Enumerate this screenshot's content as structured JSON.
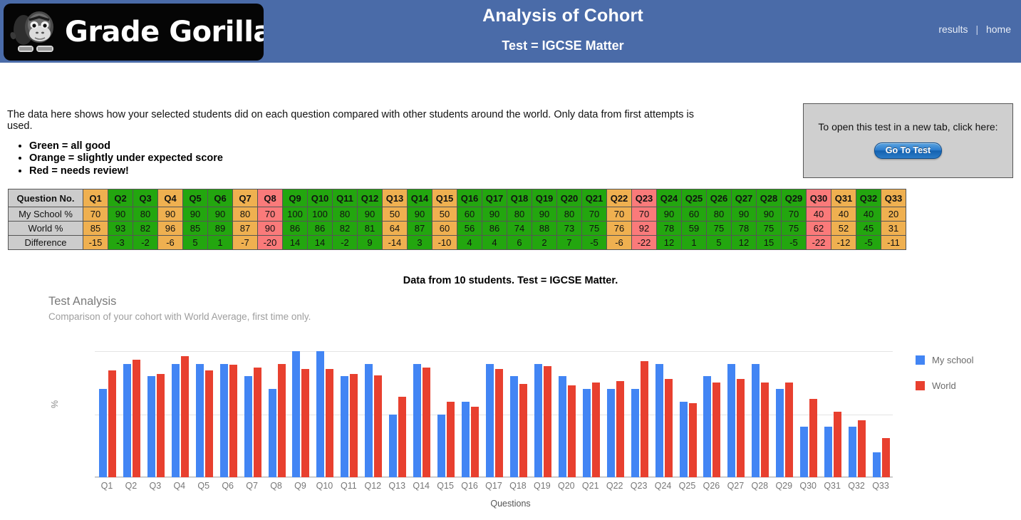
{
  "header": {
    "logo_text": "Grade Gorilla",
    "title": "Analysis of Cohort",
    "subtitle": "Test = IGCSE Matter",
    "link_results": "results",
    "link_sep": "|",
    "link_home": "home"
  },
  "intro": {
    "paragraph": "The data here shows how your selected students did on each question compared with other students around the world. Only data from first attempts is used.",
    "bullets": [
      "Green = all good",
      "Orange = slightly under expected score",
      "Red = needs review!"
    ]
  },
  "test_panel": {
    "text": "To open this test in a new tab, click here:",
    "button_label": "Go To Test"
  },
  "table": {
    "row_labels": [
      "Question No.",
      "My School %",
      "World %",
      "Difference"
    ],
    "caption": "Data from 10 students. Test = IGCSE Matter."
  },
  "colors": {
    "green": "#23a60f",
    "orange": "#efb050",
    "red": "#fa7a7a",
    "header_blue": "#4a6ba8",
    "series_my_school": "#4285f4",
    "series_world": "#e8402f"
  },
  "chart_data": {
    "type": "bar",
    "title": "Test Analysis",
    "subtitle": "Comparison of your cohort with World Average, first time only.",
    "xlabel": "Questions",
    "ylabel": "%",
    "ylim": [
      0,
      100
    ],
    "yticks": [
      0,
      50,
      100
    ],
    "grid": true,
    "legend_position": "right",
    "categories": [
      "Q1",
      "Q2",
      "Q3",
      "Q4",
      "Q5",
      "Q6",
      "Q7",
      "Q8",
      "Q9",
      "Q10",
      "Q11",
      "Q12",
      "Q13",
      "Q14",
      "Q15",
      "Q16",
      "Q17",
      "Q18",
      "Q19",
      "Q20",
      "Q21",
      "Q22",
      "Q23",
      "Q24",
      "Q25",
      "Q26",
      "Q27",
      "Q28",
      "Q29",
      "Q30",
      "Q31",
      "Q32",
      "Q33"
    ],
    "series": [
      {
        "name": "My school",
        "color": "#4285f4",
        "values": [
          70,
          90,
          80,
          90,
          90,
          90,
          80,
          70,
          100,
          100,
          80,
          90,
          50,
          90,
          50,
          60,
          90,
          80,
          90,
          80,
          70,
          70,
          70,
          90,
          60,
          80,
          90,
          90,
          70,
          40,
          40,
          40,
          20
        ]
      },
      {
        "name": "World",
        "color": "#e8402f",
        "values": [
          85,
          93,
          82,
          96,
          85,
          89,
          87,
          90,
          86,
          86,
          82,
          81,
          64,
          87,
          60,
          56,
          86,
          74,
          88,
          73,
          75,
          76,
          92,
          78,
          59,
          75,
          78,
          75,
          75,
          62,
          52,
          45,
          31
        ]
      }
    ],
    "difference": [
      -15,
      -3,
      -2,
      -6,
      5,
      1,
      -7,
      -20,
      14,
      14,
      -2,
      9,
      -14,
      3,
      -10,
      4,
      4,
      6,
      2,
      7,
      -5,
      -6,
      -22,
      12,
      1,
      5,
      12,
      15,
      -5,
      -22,
      -12,
      -5,
      -11
    ],
    "status": [
      "o",
      "g",
      "g",
      "o",
      "g",
      "g",
      "o",
      "r",
      "g",
      "g",
      "g",
      "g",
      "o",
      "g",
      "o",
      "g",
      "g",
      "g",
      "g",
      "g",
      "g",
      "o",
      "r",
      "g",
      "g",
      "g",
      "g",
      "g",
      "g",
      "r",
      "o",
      "g",
      "o"
    ]
  }
}
